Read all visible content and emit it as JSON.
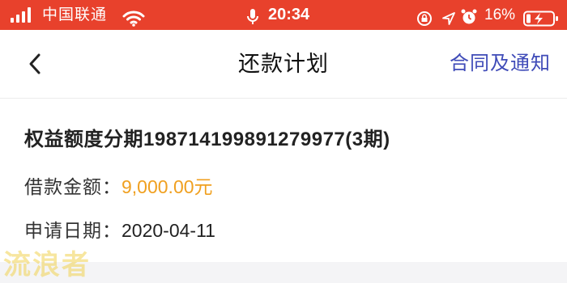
{
  "status_bar": {
    "carrier": "中国联通",
    "time": "20:34",
    "battery_percent": "16%",
    "background_color": "#e8412c"
  },
  "nav": {
    "title": "还款计划",
    "right_link": "合同及通知",
    "back_icon": "chevron-left-icon",
    "link_color": "#3f4bb8"
  },
  "plan": {
    "title": "权益额度分期",
    "plan_number": "198714199891279977",
    "periods": "(3期)",
    "amount_label": "借款金额：",
    "amount_value": "9,000.00元",
    "amount_color": "#f0a020",
    "date_label": "申请日期：",
    "date_value": "2020-04-11"
  },
  "watermark": {
    "text": "流浪者"
  }
}
